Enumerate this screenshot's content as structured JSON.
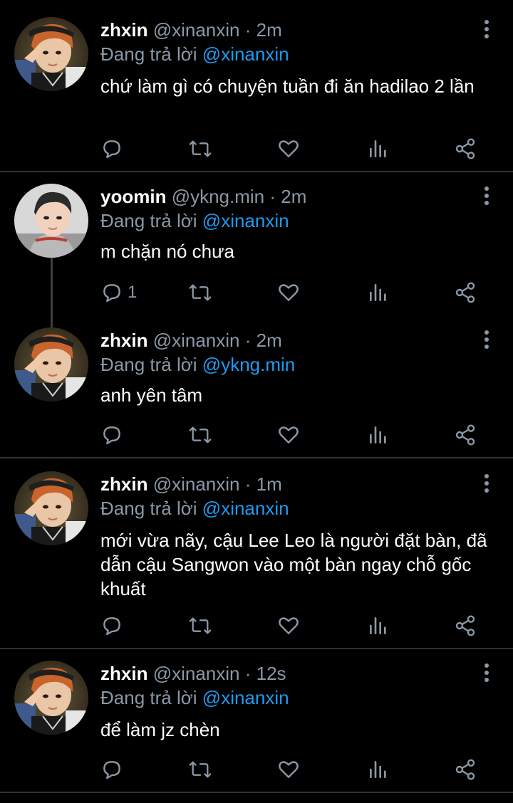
{
  "tweets": [
    {
      "name": "zhxin",
      "handle": "@xinanxin",
      "time": "2m",
      "reply_label": "Đang trả lời",
      "reply_to": "@xinanxin",
      "text": "chứ làm gì có chuyện tuần đi ăn hadilao 2 lần",
      "reply_count": ""
    },
    {
      "name": "yoomin",
      "handle": "@ykng.min",
      "time": "2m",
      "reply_label": "Đang trả lời",
      "reply_to": "@xinanxin",
      "text": "m chặn nó chưa",
      "reply_count": "1"
    },
    {
      "name": "zhxin",
      "handle": "@xinanxin",
      "time": "2m",
      "reply_label": "Đang trả lời",
      "reply_to": "@ykng.min",
      "text": "anh yên tâm",
      "reply_count": ""
    },
    {
      "name": "zhxin",
      "handle": "@xinanxin",
      "time": "1m",
      "reply_label": "Đang trả lời",
      "reply_to": "@xinanxin",
      "text": "mới vừa nãy, cậu Lee Leo là người đặt bàn, đã dẫn cậu Sangwon vào một bàn ngay chỗ gốc khuất",
      "reply_count": ""
    },
    {
      "name": "zhxin",
      "handle": "@xinanxin",
      "time": "12s",
      "reply_label": "Đang trả lời",
      "reply_to": "@xinanxin",
      "text": "để làm jz chèn",
      "reply_count": ""
    }
  ],
  "separator": "·",
  "icons": [
    "reply-icon",
    "retweet-icon",
    "like-icon",
    "views-icon",
    "share-icon",
    "more-icon"
  ],
  "colors": {
    "background": "#000000",
    "text": "#ffffff",
    "muted": "#8b98a5",
    "mention": "#1d9bf0",
    "divider": "#2f3336"
  }
}
